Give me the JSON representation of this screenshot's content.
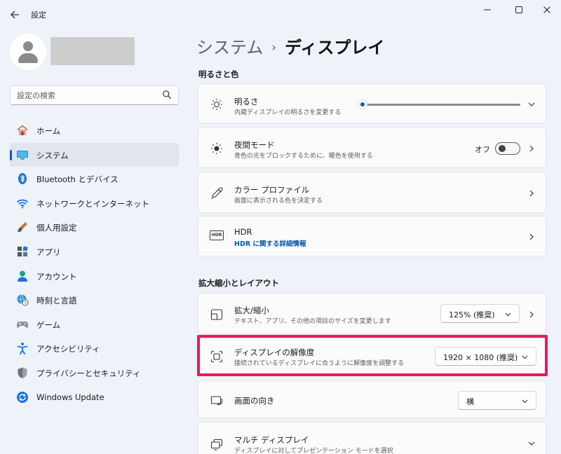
{
  "window": {
    "title": "設定",
    "back_icon": "arrow-left-icon",
    "controls": [
      "minimize-icon",
      "maximize-icon",
      "close-icon"
    ]
  },
  "search": {
    "placeholder": "設定の検索"
  },
  "sidebar": {
    "items": [
      {
        "label": "ホーム",
        "icon": "home-icon",
        "selected": false
      },
      {
        "label": "システム",
        "icon": "system-icon",
        "selected": true
      },
      {
        "label": "Bluetooth とデバイス",
        "icon": "bluetooth-icon",
        "selected": false
      },
      {
        "label": "ネットワークとインターネット",
        "icon": "wifi-icon",
        "selected": false
      },
      {
        "label": "個人用設定",
        "icon": "brush-icon",
        "selected": false
      },
      {
        "label": "アプリ",
        "icon": "apps-icon",
        "selected": false
      },
      {
        "label": "アカウント",
        "icon": "account-icon",
        "selected": false
      },
      {
        "label": "時刻と言語",
        "icon": "globe-clock-icon",
        "selected": false
      },
      {
        "label": "ゲーム",
        "icon": "gamepad-icon",
        "selected": false
      },
      {
        "label": "アクセシビリティ",
        "icon": "accessibility-icon",
        "selected": false
      },
      {
        "label": "プライバシーとセキュリティ",
        "icon": "shield-icon",
        "selected": false
      },
      {
        "label": "Windows Update",
        "icon": "update-icon",
        "selected": false
      }
    ]
  },
  "breadcrumb": {
    "parent": "システム",
    "separator": "›",
    "current": "ディスプレイ"
  },
  "sections": {
    "brightness_color": "明るさと色",
    "scale_layout": "拡大縮小とレイアウト"
  },
  "cards": {
    "brightness": {
      "title": "明るさ",
      "subtitle": "内蔵ディスプレイの明るさを変更する",
      "level_percent": 0
    },
    "night_light": {
      "title": "夜間モード",
      "subtitle": "青色の光をブロックするために、暖色を使用する",
      "state_label": "オフ",
      "on": false
    },
    "color_profile": {
      "title": "カラー プロファイル",
      "subtitle": "画面に表示される色を決定する"
    },
    "hdr": {
      "title": "HDR",
      "link": "HDR に関する詳細情報",
      "icon_text": "HDR"
    },
    "scale": {
      "title": "拡大/縮小",
      "subtitle": "テキスト、アプリ、その他の項目のサイズを変更します",
      "value": "125% (推奨)"
    },
    "resolution": {
      "title": "ディスプレイの解像度",
      "subtitle": "接続されているディスプレイに合うように解像度を調整する",
      "value": "1920 × 1080 (推奨)"
    },
    "orientation": {
      "title": "画面の向き",
      "value": "横"
    },
    "multi_display": {
      "title": "マルチ ディスプレイ",
      "subtitle": "ディスプレイに対してプレゼンテーション モードを選択"
    }
  },
  "colors": {
    "accent": "#005fb8",
    "highlight": "#e8195c",
    "link": "#0b57a8"
  }
}
